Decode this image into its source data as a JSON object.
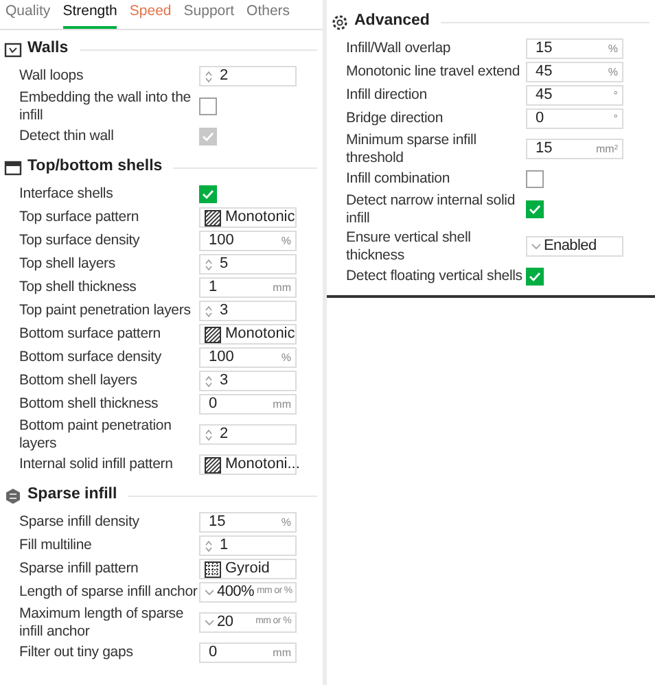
{
  "tabs": [
    {
      "label": "Quality",
      "selected": false,
      "modified": false
    },
    {
      "label": "Strength",
      "selected": true,
      "modified": false
    },
    {
      "label": "Speed",
      "selected": false,
      "modified": true
    },
    {
      "label": "Support",
      "selected": false,
      "modified": false
    },
    {
      "label": "Others",
      "selected": false,
      "modified": false
    }
  ],
  "left_sections": [
    {
      "title": "Walls",
      "rows": [
        {
          "label": "Wall loops",
          "kind": "spin",
          "value": "2"
        },
        {
          "label": "Embedding the wall into the infill",
          "kind": "checkbox",
          "checked": false,
          "disabled": false
        },
        {
          "label": "Detect thin wall",
          "kind": "checkbox",
          "checked": true,
          "disabled": true
        }
      ]
    },
    {
      "title": "Top/bottom shells",
      "rows": [
        {
          "label": "Interface shells",
          "kind": "checkbox",
          "checked": true,
          "disabled": false
        },
        {
          "label": "Top surface pattern",
          "kind": "pattern",
          "value": "Monotonic"
        },
        {
          "label": "Top surface density",
          "kind": "number",
          "value": "100",
          "unit": "%"
        },
        {
          "label": "Top shell layers",
          "kind": "spin",
          "value": "5"
        },
        {
          "label": "Top shell thickness",
          "kind": "number",
          "value": "1",
          "unit": "mm"
        },
        {
          "label": "Top paint penetration layers",
          "kind": "spin",
          "value": "3"
        },
        {
          "label": "Bottom surface pattern",
          "kind": "pattern",
          "value": "Monotonic"
        },
        {
          "label": "Bottom surface density",
          "kind": "number",
          "value": "100",
          "unit": "%"
        },
        {
          "label": "Bottom shell layers",
          "kind": "spin",
          "value": "3"
        },
        {
          "label": "Bottom shell thickness",
          "kind": "number",
          "value": "0",
          "unit": "mm"
        },
        {
          "label": "Bottom paint penetration layers",
          "kind": "spin",
          "value": "2"
        },
        {
          "label": "Internal solid infill pattern",
          "kind": "pattern",
          "value": "Monotoni..."
        }
      ]
    },
    {
      "title": "Sparse infill",
      "rows": [
        {
          "label": "Sparse infill density",
          "kind": "number",
          "value": "15",
          "unit": "%"
        },
        {
          "label": "Fill multiline",
          "kind": "spin",
          "value": "1"
        },
        {
          "label": "Sparse infill pattern",
          "kind": "lattice",
          "value": "Gyroid"
        },
        {
          "label": "Length of sparse infill anchor",
          "kind": "combo",
          "value": "400%",
          "unit": "mm or %"
        },
        {
          "label": "Maximum length of sparse infill anchor",
          "kind": "combo",
          "value": "20",
          "unit": "mm or %"
        },
        {
          "label": "Filter out tiny gaps",
          "kind": "number",
          "value": "0",
          "unit": "mm"
        }
      ]
    }
  ],
  "right_sections": [
    {
      "title": "Advanced",
      "rows": [
        {
          "label": "Infill/Wall overlap",
          "kind": "number",
          "value": "15",
          "unit": "%"
        },
        {
          "label": "Monotonic line travel extend",
          "kind": "number",
          "value": "45",
          "unit": "%"
        },
        {
          "label": "Infill direction",
          "kind": "number",
          "value": "45",
          "unit": "°"
        },
        {
          "label": "Bridge direction",
          "kind": "number",
          "value": "0",
          "unit": "°"
        },
        {
          "label": "Minimum sparse infill threshold",
          "kind": "number",
          "value": "15",
          "unit": "mm²"
        },
        {
          "label": "Infill combination",
          "kind": "checkbox",
          "checked": false,
          "disabled": false
        },
        {
          "label": "Detect narrow internal solid infill",
          "kind": "checkbox",
          "checked": true,
          "disabled": false
        },
        {
          "label": "Ensure vertical shell thickness",
          "kind": "combo",
          "value": "Enabled"
        },
        {
          "label": "Detect floating vertical shells",
          "kind": "checkbox",
          "checked": true,
          "disabled": false
        }
      ]
    }
  ]
}
